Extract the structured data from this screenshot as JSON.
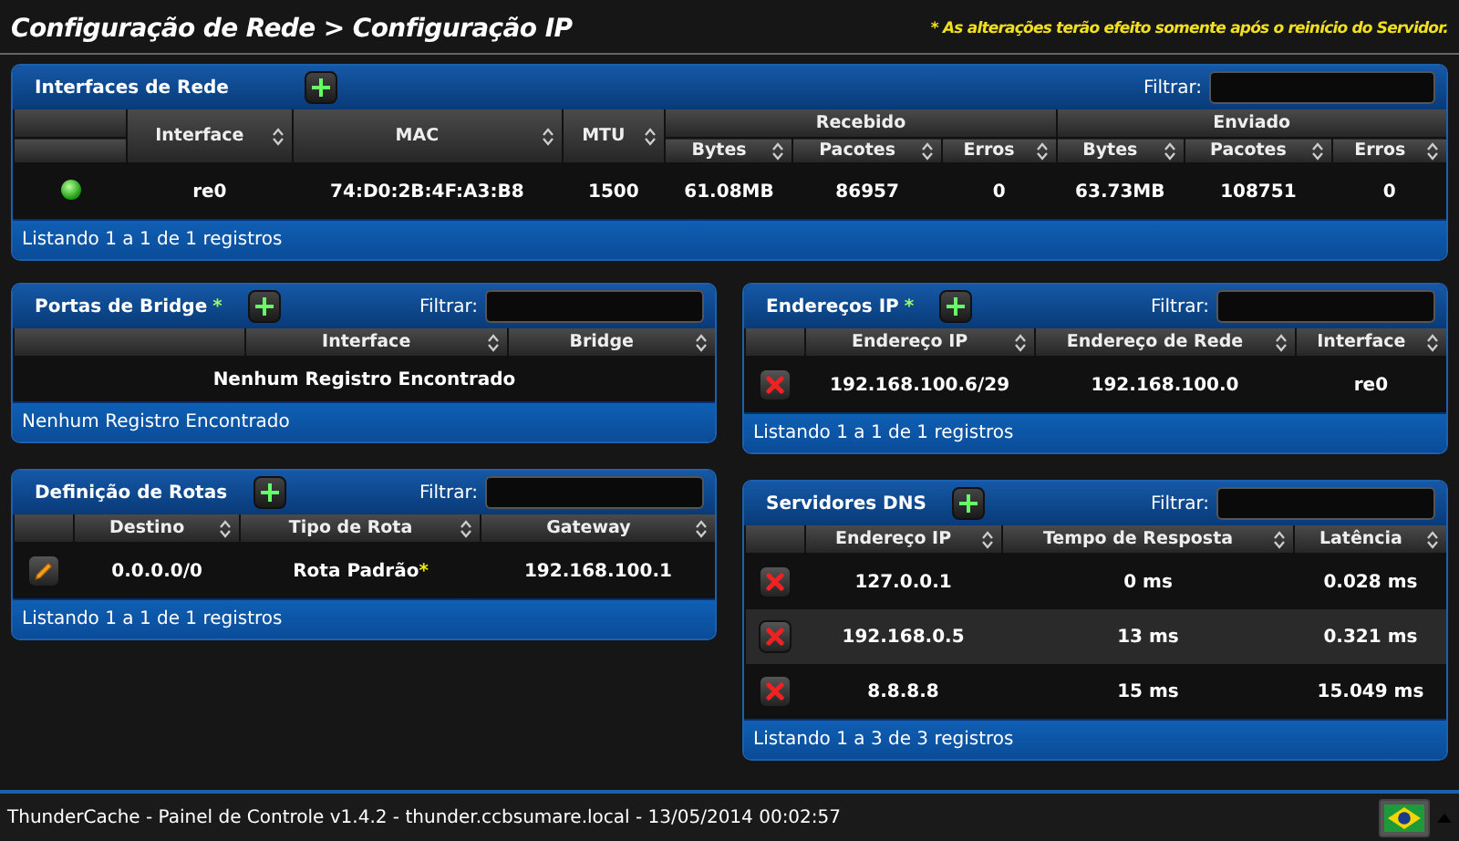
{
  "header": {
    "title": "Configuração de Rede > Configuração IP",
    "notice": "* As alterações terão efeito somente após o reinício do Servidor."
  },
  "interfaces_panel": {
    "title": "Interfaces de Rede",
    "filter_label": "Filtrar:",
    "columns": [
      {
        "label": "Interface"
      },
      {
        "label": "MAC"
      },
      {
        "label": "MTU"
      },
      {
        "label": "Recebido",
        "colspan": 3,
        "children": [
          {
            "label": "Bytes"
          },
          {
            "label": "Pacotes"
          },
          {
            "label": "Erros"
          }
        ]
      },
      {
        "label": "Enviado",
        "colspan": 3,
        "children": [
          {
            "label": "Bytes"
          },
          {
            "label": "Pacotes"
          },
          {
            "label": "Erros"
          }
        ]
      }
    ],
    "rows": [
      {
        "kind": "status",
        "cells": [
          "re0",
          "74:D0:2B:4F:A3:B8",
          "1500",
          "61.08MB",
          "86957",
          "0",
          "63.73MB",
          "108751",
          "0"
        ]
      }
    ],
    "footer": "Listando 1 a 1 de 1 registros"
  },
  "left_panels": [
    {
      "title": "Portas de Bridge",
      "star": "*",
      "filter_label": "Filtrar:",
      "columns": [
        {
          "label": "Interface"
        },
        {
          "label": "Bridge"
        }
      ],
      "empty_message": "Nenhum Registro Encontrado",
      "footer": "Nenhum Registro Encontrado"
    },
    {
      "title": "Definição de Rotas",
      "filter_label": "Filtrar:",
      "columns": [
        {
          "label": "Destino"
        },
        {
          "label": "Tipo de Rota"
        },
        {
          "label": "Gateway"
        }
      ],
      "rows": [
        {
          "kind": "edit",
          "cells": [
            "0.0.0.0/0",
            {
              "text": "Rota Padrão",
              "star": "*"
            },
            "192.168.100.1"
          ]
        }
      ],
      "footer": "Listando 1 a 1 de 1 registros"
    }
  ],
  "right_panels": [
    {
      "title": "Endereços IP",
      "star": "*",
      "filter_label": "Filtrar:",
      "columns": [
        {
          "label": "Endereço IP"
        },
        {
          "label": "Endereço de Rede"
        },
        {
          "label": "Interface"
        }
      ],
      "rows": [
        {
          "kind": "delete",
          "cells": [
            "192.168.100.6/29",
            "192.168.100.0",
            "re0"
          ]
        }
      ],
      "footer": "Listando 1 a 1 de 1 registros"
    },
    {
      "title": "Servidores DNS",
      "filter_label": "Filtrar:",
      "columns": [
        {
          "label": "Endereço IP"
        },
        {
          "label": "Tempo de Resposta"
        },
        {
          "label": "Latência"
        }
      ],
      "rows": [
        {
          "kind": "delete",
          "cells": [
            "127.0.0.1",
            "0 ms",
            "0.028 ms"
          ]
        },
        {
          "kind": "delete",
          "cells": [
            "192.168.0.5",
            "13 ms",
            "0.321 ms"
          ]
        },
        {
          "kind": "delete",
          "cells": [
            "8.8.8.8",
            "15 ms",
            "15.049 ms"
          ]
        }
      ],
      "footer": "Listando 1 a 3 de 3 registros"
    }
  ],
  "status_bar": {
    "text": "ThunderCache - Painel de Controle v1.4.2 - thunder.ccbsumare.local - 13/05/2014 00:02:57"
  }
}
